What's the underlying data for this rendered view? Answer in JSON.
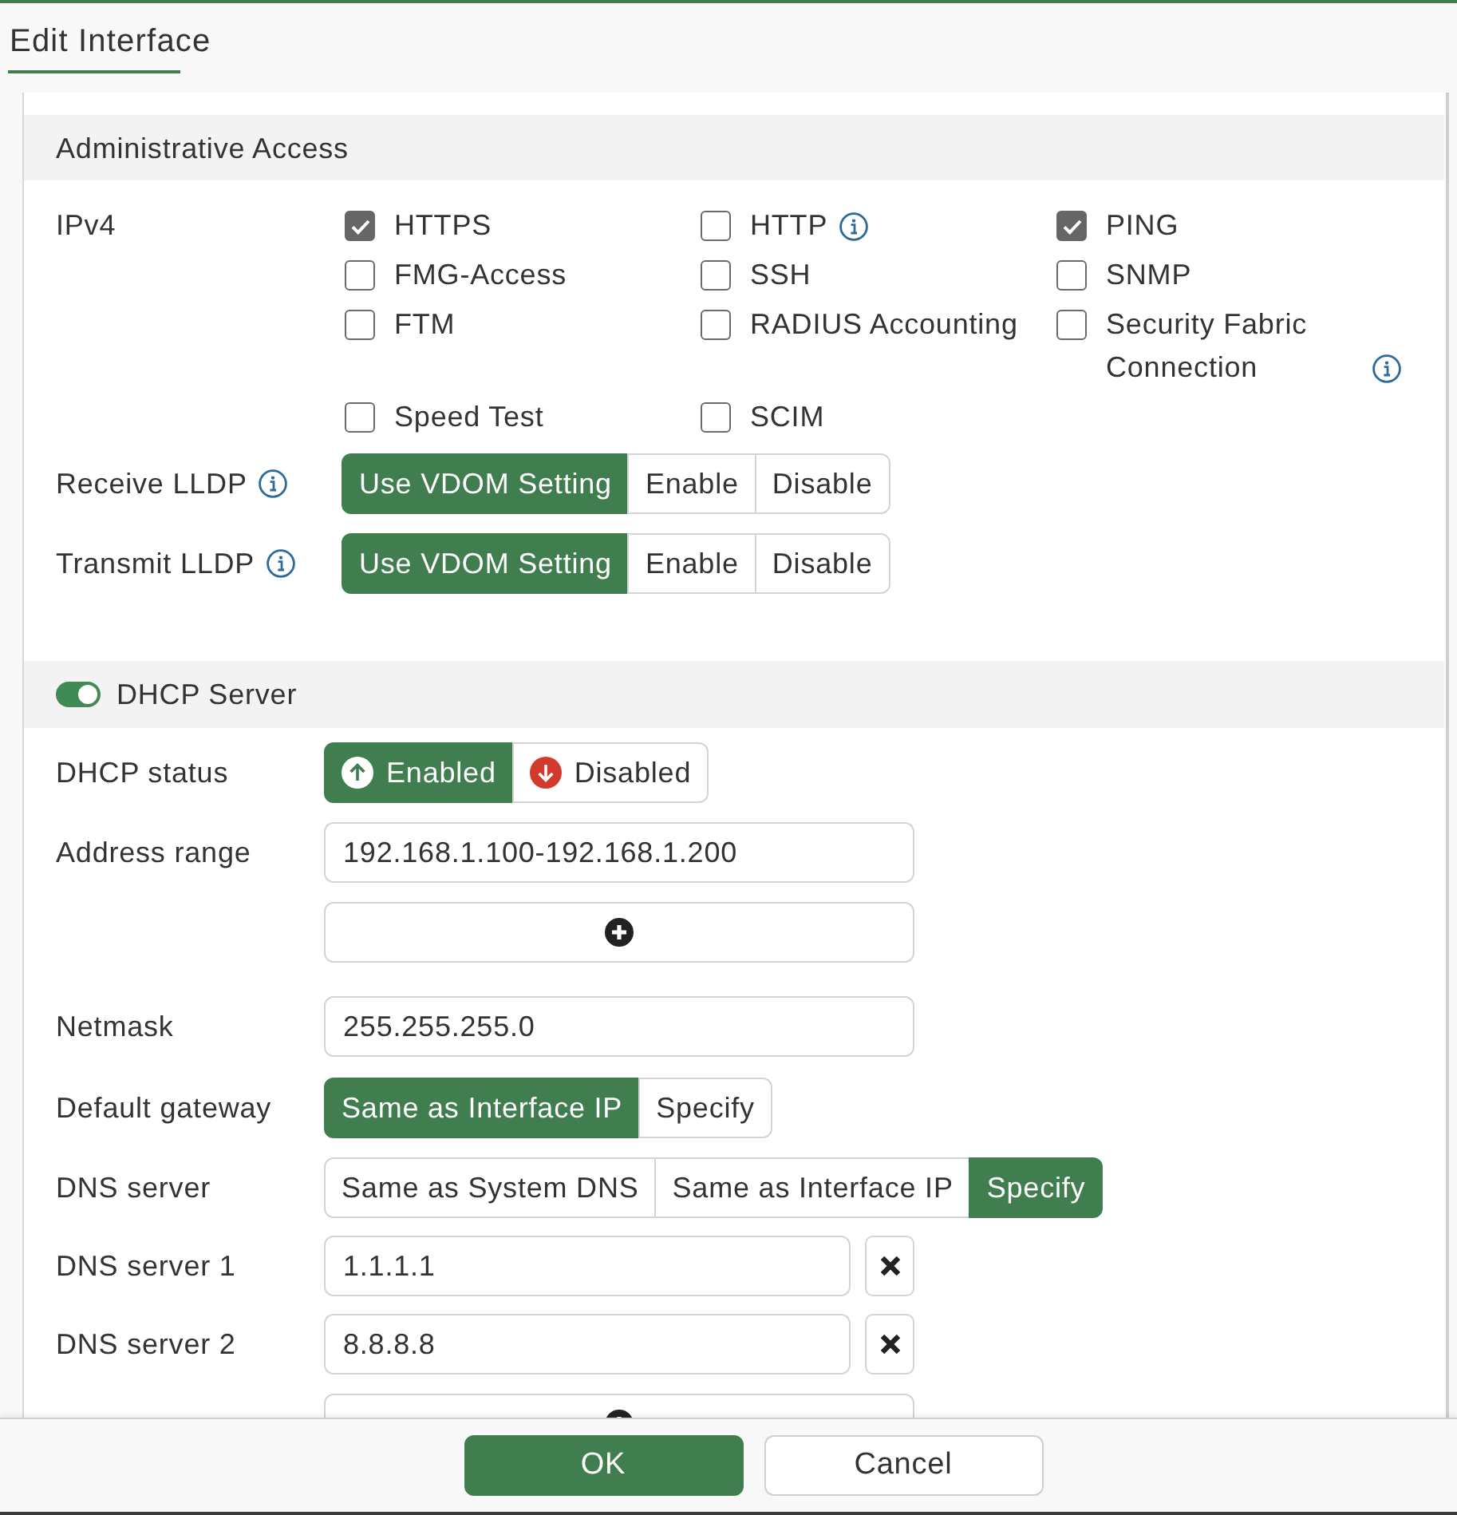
{
  "window": {
    "title": "Edit Interface"
  },
  "administrative_access": {
    "title": "Administrative Access",
    "ipv4": {
      "label": "IPv4",
      "options": [
        {
          "label": "HTTPS",
          "checked": true,
          "info": false
        },
        {
          "label": "HTTP",
          "checked": false,
          "info": true
        },
        {
          "label": "PING",
          "checked": true,
          "info": false
        },
        {
          "label": "FMG-Access",
          "checked": false,
          "info": false
        },
        {
          "label": "SSH",
          "checked": false,
          "info": false
        },
        {
          "label": "SNMP",
          "checked": false,
          "info": false
        },
        {
          "label": "FTM",
          "checked": false,
          "info": false
        },
        {
          "label": "RADIUS Accounting",
          "checked": false,
          "info": false
        },
        {
          "label": "Security Fabric Connection",
          "checked": false,
          "info": true
        },
        {
          "label": "Speed Test",
          "checked": false,
          "info": false
        },
        {
          "label": "SCIM",
          "checked": false,
          "info": false
        }
      ]
    },
    "lldp": [
      {
        "label": "Receive LLDP",
        "info": true,
        "options": [
          {
            "label": "Use VDOM Setting",
            "selected": true
          },
          {
            "label": "Enable",
            "selected": false
          },
          {
            "label": "Disable",
            "selected": false
          }
        ]
      },
      {
        "label": "Transmit LLDP",
        "info": true,
        "options": [
          {
            "label": "Use VDOM Setting",
            "selected": true
          },
          {
            "label": "Enable",
            "selected": false
          },
          {
            "label": "Disable",
            "selected": false
          }
        ]
      }
    ]
  },
  "dhcp_server": {
    "title": "DHCP Server",
    "enabled": true,
    "status": {
      "label": "DHCP status",
      "options": [
        {
          "label": "Enabled",
          "kind": "enable",
          "selected": true
        },
        {
          "label": "Disabled",
          "kind": "disable",
          "selected": false
        }
      ]
    },
    "address_range": {
      "label": "Address range",
      "values": [
        "192.168.1.100-192.168.1.200"
      ]
    },
    "netmask": {
      "label": "Netmask",
      "value": "255.255.255.0"
    },
    "default_gateway": {
      "label": "Default gateway",
      "options": [
        {
          "label": "Same as Interface IP",
          "selected": true
        },
        {
          "label": "Specify",
          "selected": false
        }
      ]
    },
    "dns_server": {
      "label": "DNS server",
      "options": [
        {
          "label": "Same as System DNS",
          "selected": false
        },
        {
          "label": "Same as Interface IP",
          "selected": false
        },
        {
          "label": "Specify",
          "selected": true
        }
      ]
    },
    "dns_servers": [
      {
        "label": "DNS server 1",
        "value": "1.1.1.1"
      },
      {
        "label": "DNS server 2",
        "value": "8.8.8.8"
      }
    ]
  },
  "buttons": [
    {
      "label": "OK",
      "kind": "primary"
    },
    {
      "label": "Cancel",
      "kind": "secondary"
    }
  ]
}
